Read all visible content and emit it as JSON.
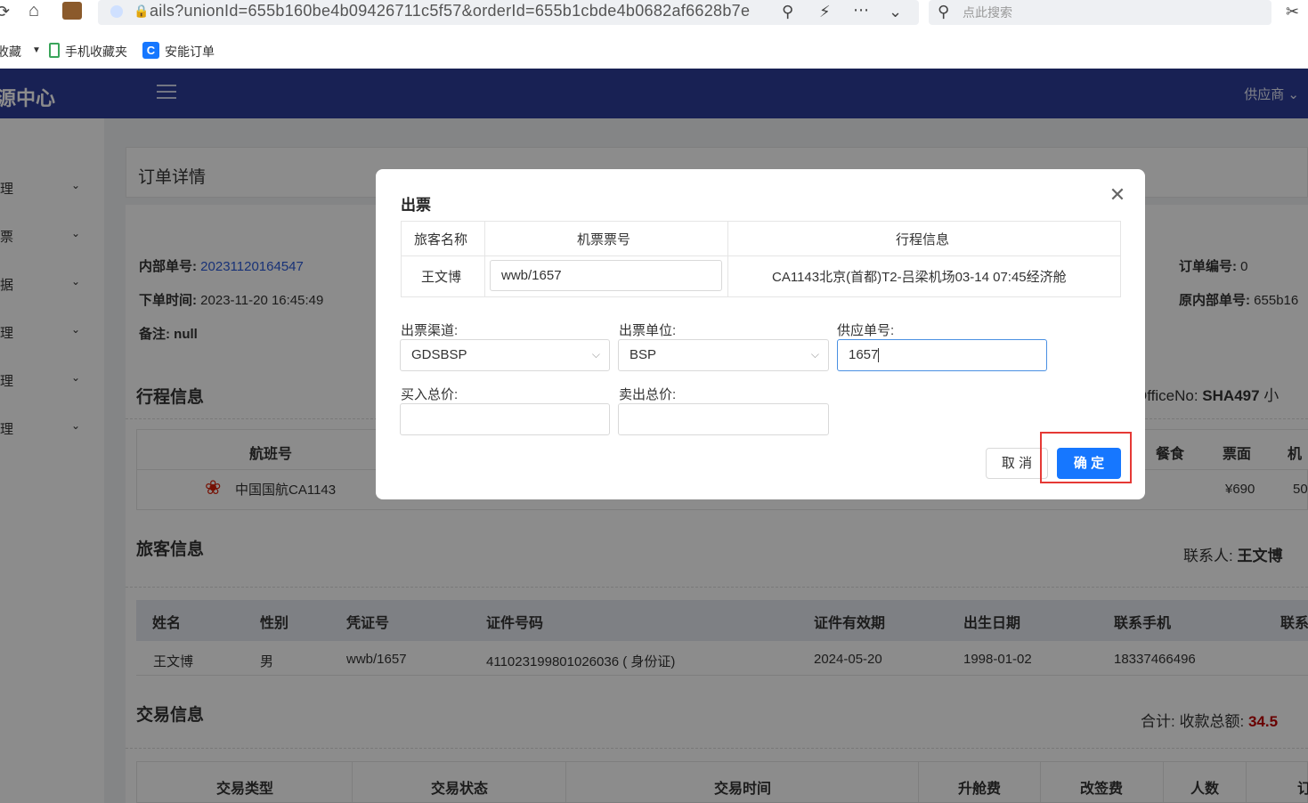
{
  "browser": {
    "url": "ails?unionId=655b160be4b09426711c5f57&orderId=655b1cbde4b0682af6628b7e",
    "search_placeholder": "点此搜索",
    "bookmarks": [
      "收藏",
      "手机收藏夹",
      "安能订单"
    ]
  },
  "header": {
    "title": "源中心",
    "user_menu": "供应商"
  },
  "sidebar": {
    "items": [
      {
        "label": "理"
      },
      {
        "label": "票"
      },
      {
        "label": "据"
      },
      {
        "label": "理"
      },
      {
        "label": "理"
      },
      {
        "label": "理"
      }
    ]
  },
  "page": {
    "title": "订单详情",
    "internal_no_label": "内部单号:",
    "internal_no": "20231120164547",
    "order_time_label": "下单时间:",
    "order_time": "2023-11-20 16:45:49",
    "remark_label": "备注:",
    "remark": "null",
    "order_no_label": "订单编号:",
    "order_no": "0",
    "orig_internal_label": "原内部单号:",
    "orig_internal": "655b16",
    "itinerary_title": "行程信息",
    "office_label": "OfficeNo:",
    "office_value": "SHA497",
    "office_extra": "小",
    "flight_headers": [
      "航班号",
      "餐食",
      "票面",
      "机"
    ],
    "flight_airline": "中国国航CA1143",
    "flight_price": "¥690",
    "flight_extra": "50",
    "passenger_title": "旅客信息",
    "contact_label": "联系人:",
    "contact_name": "王文博",
    "passenger_headers": [
      "姓名",
      "性别",
      "凭证号",
      "证件号码",
      "证件有效期",
      "出生日期",
      "联系手机",
      "联系"
    ],
    "passenger_row": [
      "王文博",
      "男",
      "wwb/1657",
      "411023199801026036 ( 身份证)",
      "2024-05-20",
      "1998-01-02",
      "18337466496"
    ],
    "trade_title": "交易信息",
    "total_label": "合计:",
    "receive_label": "收款总额:",
    "receive_value": "34.5",
    "trade_headers": [
      "交易类型",
      "交易状态",
      "交易时间",
      "升舱费",
      "改签费",
      "人数",
      "订"
    ]
  },
  "modal": {
    "title": "出票",
    "table_headers": [
      "旅客名称",
      "机票票号",
      "行程信息"
    ],
    "passenger_name": "王文博",
    "ticket_no": "wwb/1657",
    "itinerary": "CA1143北京(首都)T2-吕梁机场03-14 07:45经济舱",
    "channel_label": "出票渠道:",
    "channel_value": "GDSBSP",
    "unit_label": "出票单位:",
    "unit_value": "BSP",
    "supplier_no_label": "供应单号:",
    "supplier_no_value": "1657",
    "buy_total_label": "买入总价:",
    "buy_total_value": "",
    "sell_total_label": "卖出总价:",
    "sell_total_value": "",
    "cancel_label": "取 消",
    "ok_label": "确 定"
  },
  "colors": {
    "header_bg": "#2d3d9a",
    "primary_button": "#1677ff",
    "highlight_box": "#e53935",
    "link": "#2d5bd9",
    "amount": "#c00000"
  }
}
